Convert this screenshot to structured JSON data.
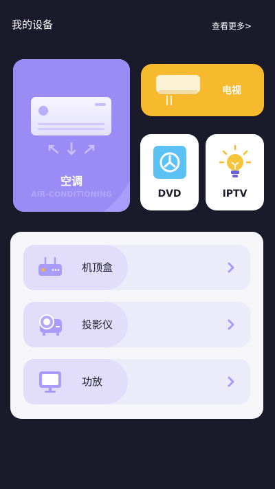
{
  "header": {
    "title": "我的设备",
    "more_link": "查看更多>"
  },
  "cards": {
    "air_conditioner": {
      "label": "空调",
      "subtitle": "AIR-CONDITIONING"
    },
    "tv": {
      "label": "电视"
    },
    "dvd": {
      "label": "DVD"
    },
    "iptv": {
      "label": "IPTV"
    }
  },
  "devices": [
    {
      "label": "机顶盒",
      "icon": "set-top-box-icon"
    },
    {
      "label": "投影仪",
      "icon": "projector-icon"
    },
    {
      "label": "功放",
      "icon": "amplifier-icon"
    }
  ],
  "colors": {
    "background": "#1b1a2b",
    "accent_purple": "#a99cfb",
    "tv_yellow": "#f7b92e",
    "dvd_blue": "#5bc2f5",
    "chevron": "#a89bf5"
  }
}
